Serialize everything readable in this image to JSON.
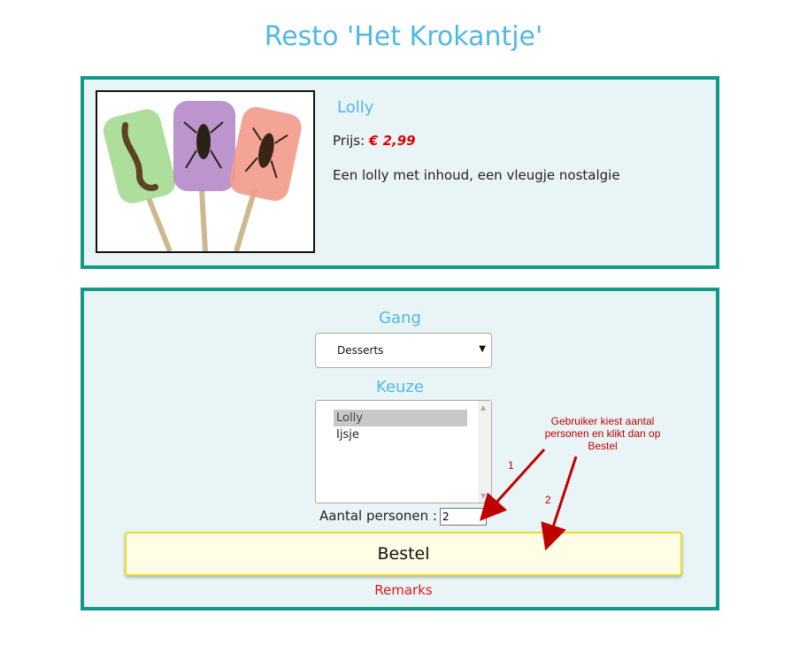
{
  "page": {
    "title": "Resto 'Het Krokantje'"
  },
  "product": {
    "image_icon": "lollipop-photo",
    "name": "Lolly",
    "price_label": "Prijs:",
    "price": "€ 2,99",
    "description": "Een lolly met inhoud, een vleugje nostalgie"
  },
  "order_form": {
    "course_heading": "Gang",
    "course_selected": "Desserts",
    "course_dropdown_icon": "caret-down-icon",
    "choice_heading": "Keuze",
    "choices": [
      {
        "label": "Lolly",
        "selected": true
      },
      {
        "label": "Ijsje",
        "selected": false
      }
    ],
    "persons_label": "Aantal personen :",
    "persons_value": "2",
    "order_button": "Bestel",
    "remarks_link": "Remarks"
  },
  "annotation": {
    "note": "Gebruiker kiest aantal personen en klikt dan op Bestel",
    "step_1": "1",
    "step_2": "2",
    "color": "#c00000"
  },
  "colors": {
    "accent": "#4fb8e6",
    "panel_border": "#12998a",
    "panel_bg": "#e9f4f6",
    "price": "#e00000",
    "button_border": "#e8dc2a"
  }
}
